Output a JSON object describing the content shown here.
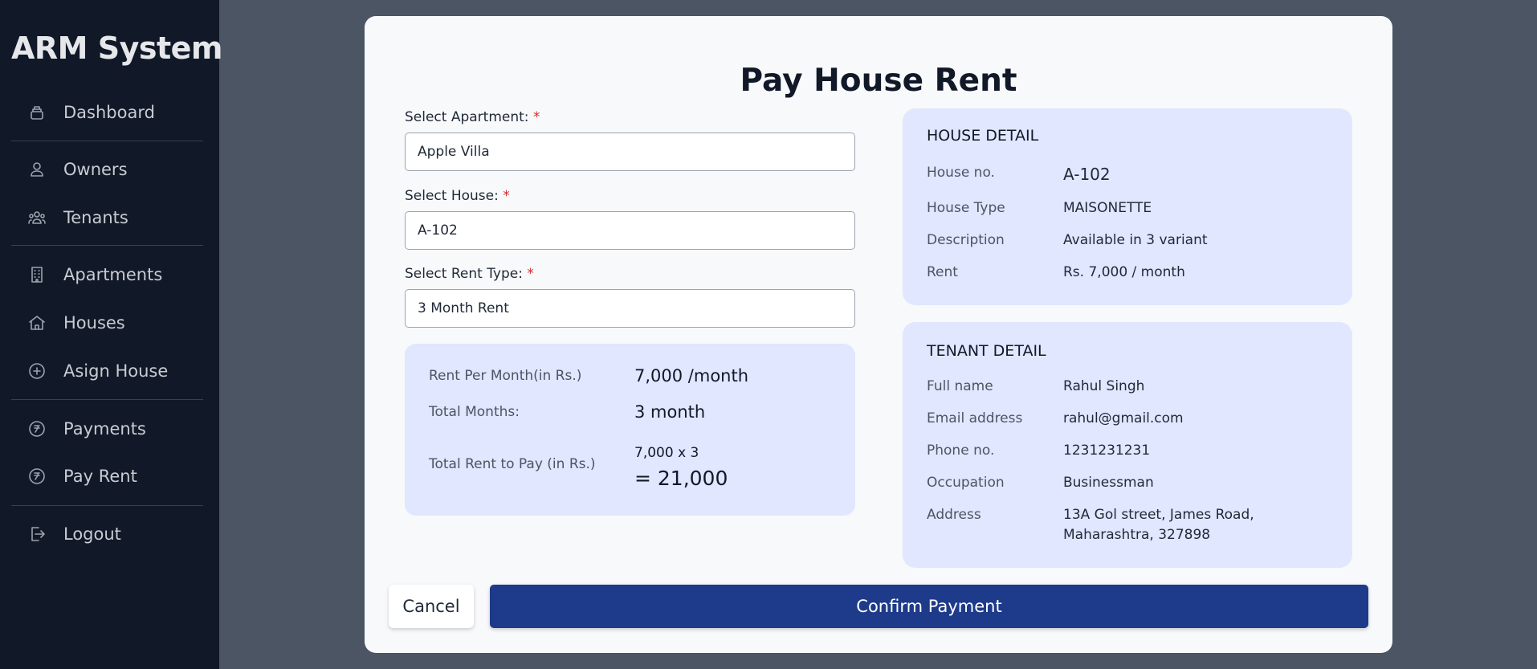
{
  "app": {
    "title": "ARM System"
  },
  "sidebar": {
    "items": [
      {
        "label": "Dashboard",
        "icon": "inbox-stack-icon"
      },
      {
        "label": "Owners",
        "icon": "user-icon"
      },
      {
        "label": "Tenants",
        "icon": "users-icon"
      },
      {
        "label": "Apartments",
        "icon": "building-icon"
      },
      {
        "label": "Houses",
        "icon": "home-icon"
      },
      {
        "label": "Asign House",
        "icon": "plus-circle-icon"
      },
      {
        "label": "Payments",
        "icon": "rupee-icon"
      },
      {
        "label": "Pay Rent",
        "icon": "rupee-icon"
      },
      {
        "label": "Logout",
        "icon": "logout-icon"
      }
    ]
  },
  "modal": {
    "title": "Pay House Rent",
    "required_mark": "*",
    "form": {
      "apartment": {
        "label": "Select Apartment:",
        "value": "Apple Villa"
      },
      "house": {
        "label": "Select House:",
        "value": "A-102"
      },
      "rent_type": {
        "label": "Select Rent Type:",
        "value": "3 Month Rent"
      }
    },
    "summary": {
      "rent_per_month_label": "Rent Per Month(in Rs.)",
      "rent_per_month_value": "7,000 /month",
      "total_months_label": "Total Months:",
      "total_months_value": "3 month",
      "total_rent_label": "Total Rent to Pay (in Rs.)",
      "total_rent_formula": "7,000 x 3",
      "total_rent_value": "= 21,000"
    },
    "house_detail": {
      "title": "HOUSE DETAIL",
      "rows": [
        {
          "label": "House no.",
          "value": "A-102"
        },
        {
          "label": "House Type",
          "value": "MAISONETTE"
        },
        {
          "label": "Description",
          "value": "Available in 3 variant"
        },
        {
          "label": "Rent",
          "value": "Rs. 7,000 / month"
        }
      ]
    },
    "tenant_detail": {
      "title": "TENANT DETAIL",
      "rows": [
        {
          "label": "Full name",
          "value": "Rahul Singh"
        },
        {
          "label": "Email address",
          "value": "rahul@gmail.com"
        },
        {
          "label": "Phone no.",
          "value": "1231231231"
        },
        {
          "label": "Occupation",
          "value": "Businessman"
        },
        {
          "label": "Address",
          "value": "13A Gol street, James Road,",
          "value2": "Maharashtra, 327898"
        }
      ]
    },
    "buttons": {
      "cancel": "Cancel",
      "confirm": "Confirm Payment"
    }
  },
  "colors": {
    "sidebar_bg": "#111827",
    "backdrop": "#4b5563",
    "card_bg": "#e0e7ff",
    "primary": "#1e3a8a",
    "required": "#dc2626"
  }
}
